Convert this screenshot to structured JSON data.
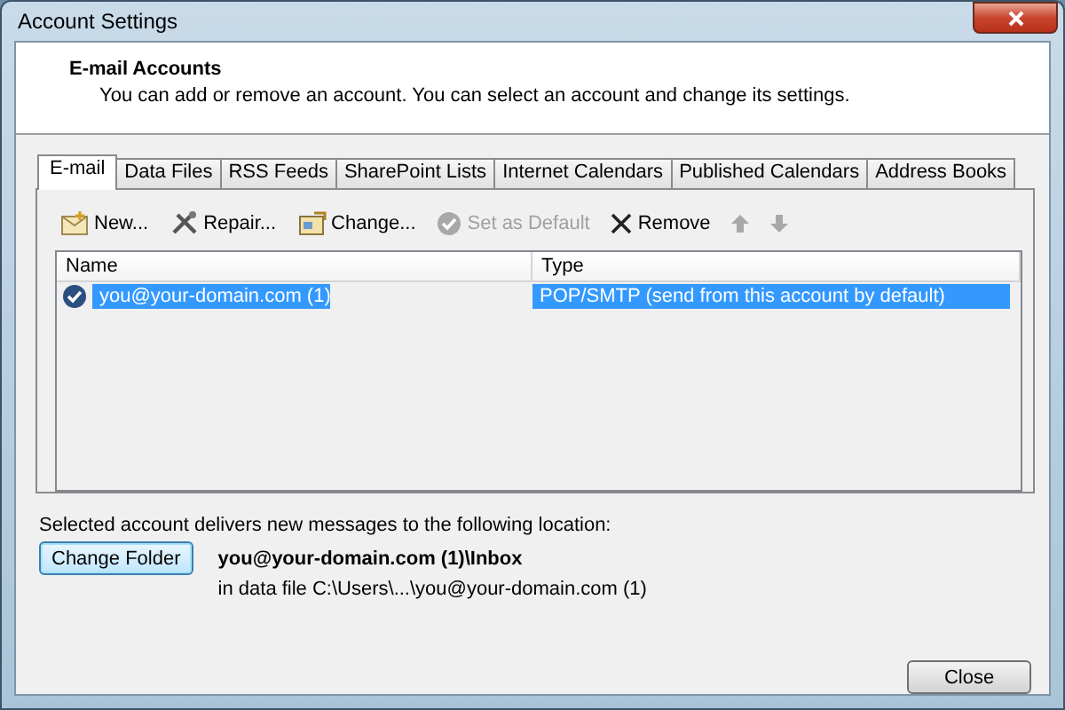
{
  "window": {
    "title": "Account Settings"
  },
  "header": {
    "title": "E-mail Accounts",
    "subtitle": "You can add or remove an account. You can select an account and change its settings."
  },
  "tabs": [
    {
      "label": "E-mail",
      "selected": true
    },
    {
      "label": "Data Files",
      "selected": false
    },
    {
      "label": "RSS Feeds",
      "selected": false
    },
    {
      "label": "SharePoint Lists",
      "selected": false
    },
    {
      "label": "Internet Calendars",
      "selected": false
    },
    {
      "label": "Published Calendars",
      "selected": false
    },
    {
      "label": "Address Books",
      "selected": false
    }
  ],
  "toolbar": [
    {
      "kind": "new",
      "label": "New...",
      "disabled": false
    },
    {
      "kind": "repair",
      "label": "Repair...",
      "disabled": false
    },
    {
      "kind": "change",
      "label": "Change...",
      "disabled": false
    },
    {
      "kind": "default",
      "label": "Set as Default",
      "disabled": true
    },
    {
      "kind": "remove",
      "label": "Remove",
      "disabled": false
    },
    {
      "kind": "up",
      "disabled": true
    },
    {
      "kind": "down",
      "disabled": true
    }
  ],
  "table": {
    "columns": [
      "Name",
      "Type"
    ],
    "rows": [
      {
        "name": "you@your-domain.com (1)",
        "type": "POP/SMTP (send from this account by default)",
        "default": true,
        "selected": true
      }
    ]
  },
  "location": {
    "caption": "Selected account delivers new messages to the following location:",
    "button": "Change Folder",
    "folder": "you@your-domain.com (1)\\Inbox",
    "data_file": "in data file C:\\Users\\...\\you@your-domain.com (1)"
  },
  "buttons": [
    "Close"
  ]
}
